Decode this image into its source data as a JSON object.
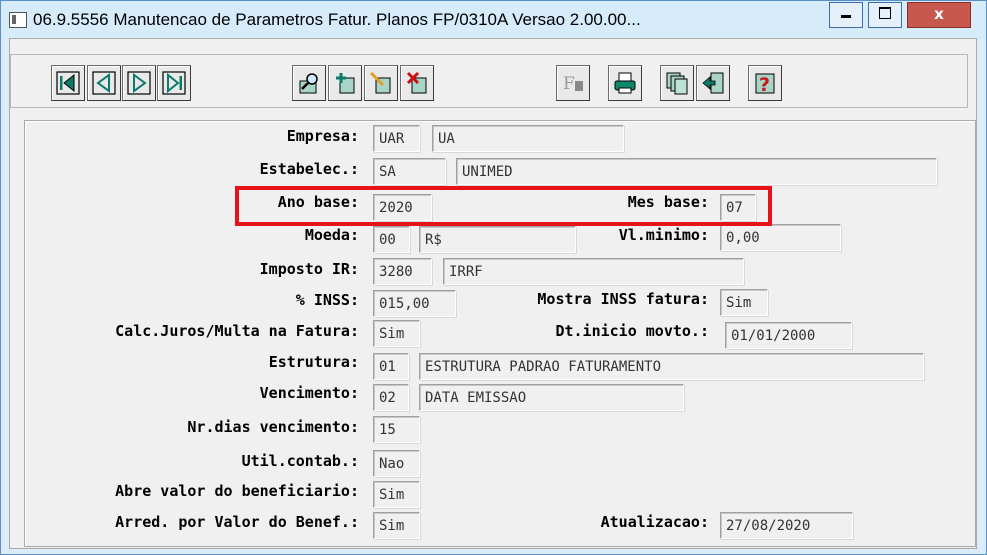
{
  "window": {
    "title": "06.9.5556 Manutencao  de Parametros Fatur. Planos FP/0310A Versao 2.00.00...",
    "close_label": "x"
  },
  "toolbar": {
    "buttons": [
      "first-record-icon",
      "previous-record-icon",
      "next-record-icon",
      "last-record-icon",
      "search-zoom-icon",
      "add-record-icon",
      "edit-record-icon",
      "delete-record-icon",
      "filter-icon",
      "print-icon",
      "copy-icon",
      "exit-icon",
      "help-icon"
    ]
  },
  "form": {
    "empresa": {
      "label": "Empresa:",
      "code": "UAR",
      "name": "UA"
    },
    "estabelec": {
      "label": "Estabelec.:",
      "code": "SA",
      "name": "UNIMED"
    },
    "ano_base": {
      "label": "Ano base:",
      "value": "2020"
    },
    "mes_base": {
      "label": "Mes base:",
      "value": "07"
    },
    "moeda": {
      "label": "Moeda:",
      "code": "00",
      "name": "R$"
    },
    "vl_minimo": {
      "label": "Vl.minimo:",
      "value": "0,00"
    },
    "imposto_ir": {
      "label": "Imposto IR:",
      "code": "3280",
      "name": "IRRF"
    },
    "inss": {
      "label": "% INSS:",
      "value": "015,00"
    },
    "mostra_inss": {
      "label": "Mostra INSS fatura:",
      "value": "Sim"
    },
    "calc_juros": {
      "label": "Calc.Juros/Multa na Fatura:",
      "value": "Sim"
    },
    "dt_inicio": {
      "label": "Dt.inicio movto.:",
      "value": "01/01/2000"
    },
    "estrutura": {
      "label": "Estrutura:",
      "code": "01",
      "name": "ESTRUTURA PADRAO FATURAMENTO"
    },
    "vencimento": {
      "label": "Vencimento:",
      "code": "02",
      "name": "DATA EMISSAO"
    },
    "nr_dias": {
      "label": "Nr.dias vencimento:",
      "value": "15"
    },
    "util_contab": {
      "label": "Util.contab.:",
      "value": "Nao"
    },
    "abre_valor": {
      "label": "Abre valor do beneficiario:",
      "value": "Sim"
    },
    "arred": {
      "label": "Arred. por Valor do Benef.:",
      "value": "Sim"
    },
    "atualizacao": {
      "label": "Atualizacao:",
      "value": "27/08/2020"
    }
  },
  "colors": {
    "highlight": "#e8131a",
    "title_bg": "#d7ecfb",
    "close_bg": "#c8574e"
  }
}
